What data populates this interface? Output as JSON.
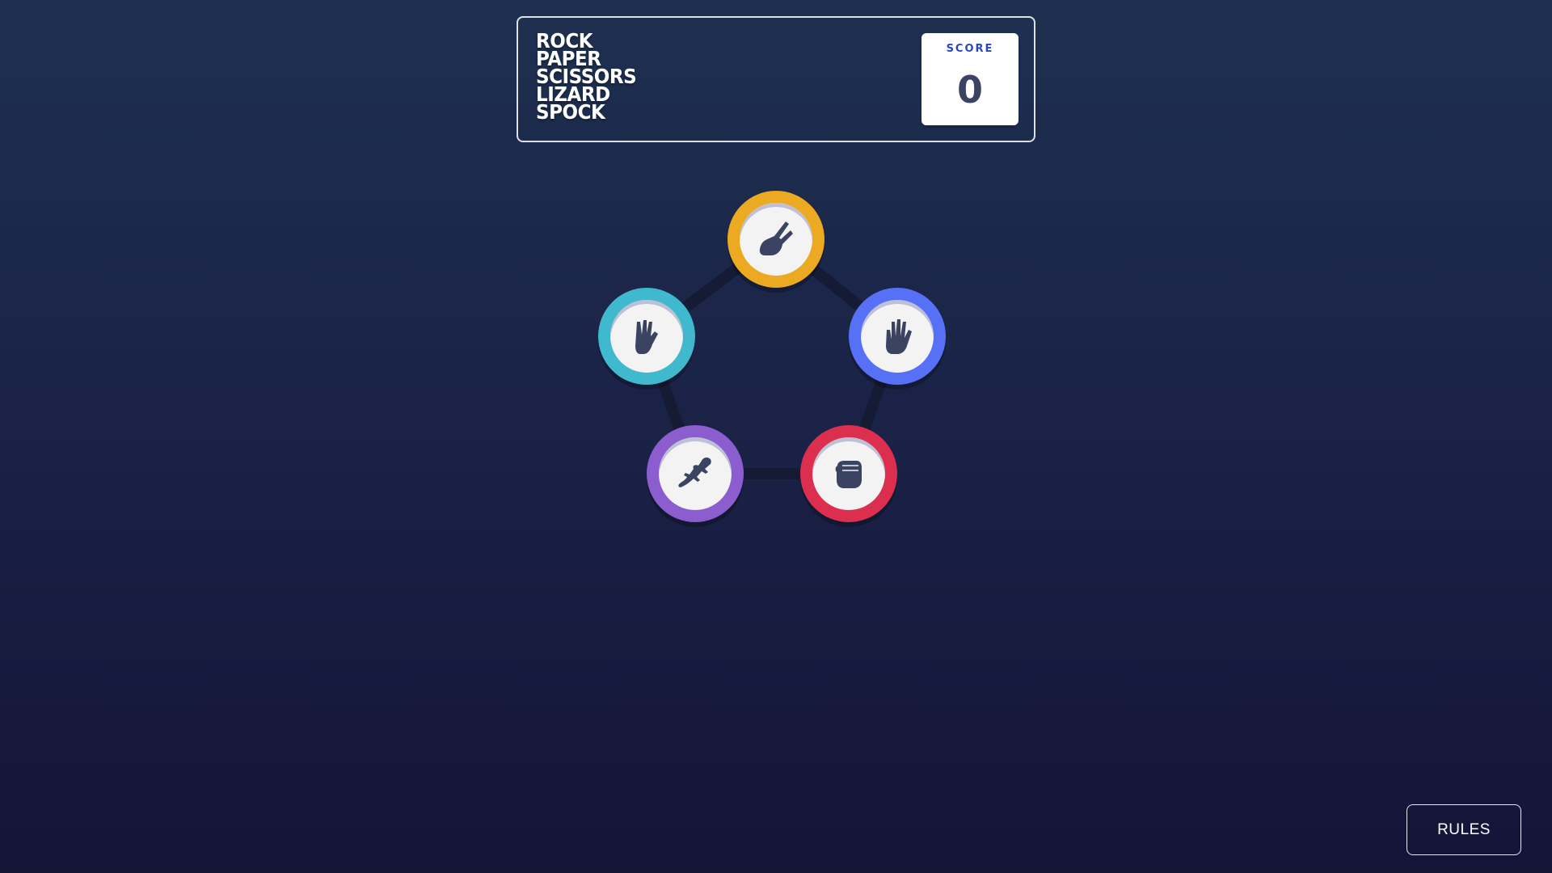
{
  "header": {
    "title_lines": [
      "ROCK",
      "PAPER",
      "SCISSORS",
      "LIZARD",
      "SPOCK"
    ],
    "score_label": "SCORE",
    "score_value": "0"
  },
  "tokens": [
    {
      "id": "scissors",
      "icon": "scissors-icon",
      "color": "#eca922"
    },
    {
      "id": "paper",
      "icon": "paper-icon",
      "color": "#5671f5"
    },
    {
      "id": "rock",
      "icon": "rock-icon",
      "color": "#dc2e4e"
    },
    {
      "id": "lizard",
      "icon": "lizard-icon",
      "color": "#8c5dcf"
    },
    {
      "id": "spock",
      "icon": "spock-icon",
      "color": "#40b9ce"
    }
  ],
  "colors": {
    "background_top": "#1e3050",
    "background_bottom": "#141437",
    "pentagon_line": "#141a30",
    "score_label": "#2a46c0",
    "score_value": "#3b4363",
    "icon_fill": "#3b4363"
  },
  "rules_button": {
    "label": "RULES"
  }
}
